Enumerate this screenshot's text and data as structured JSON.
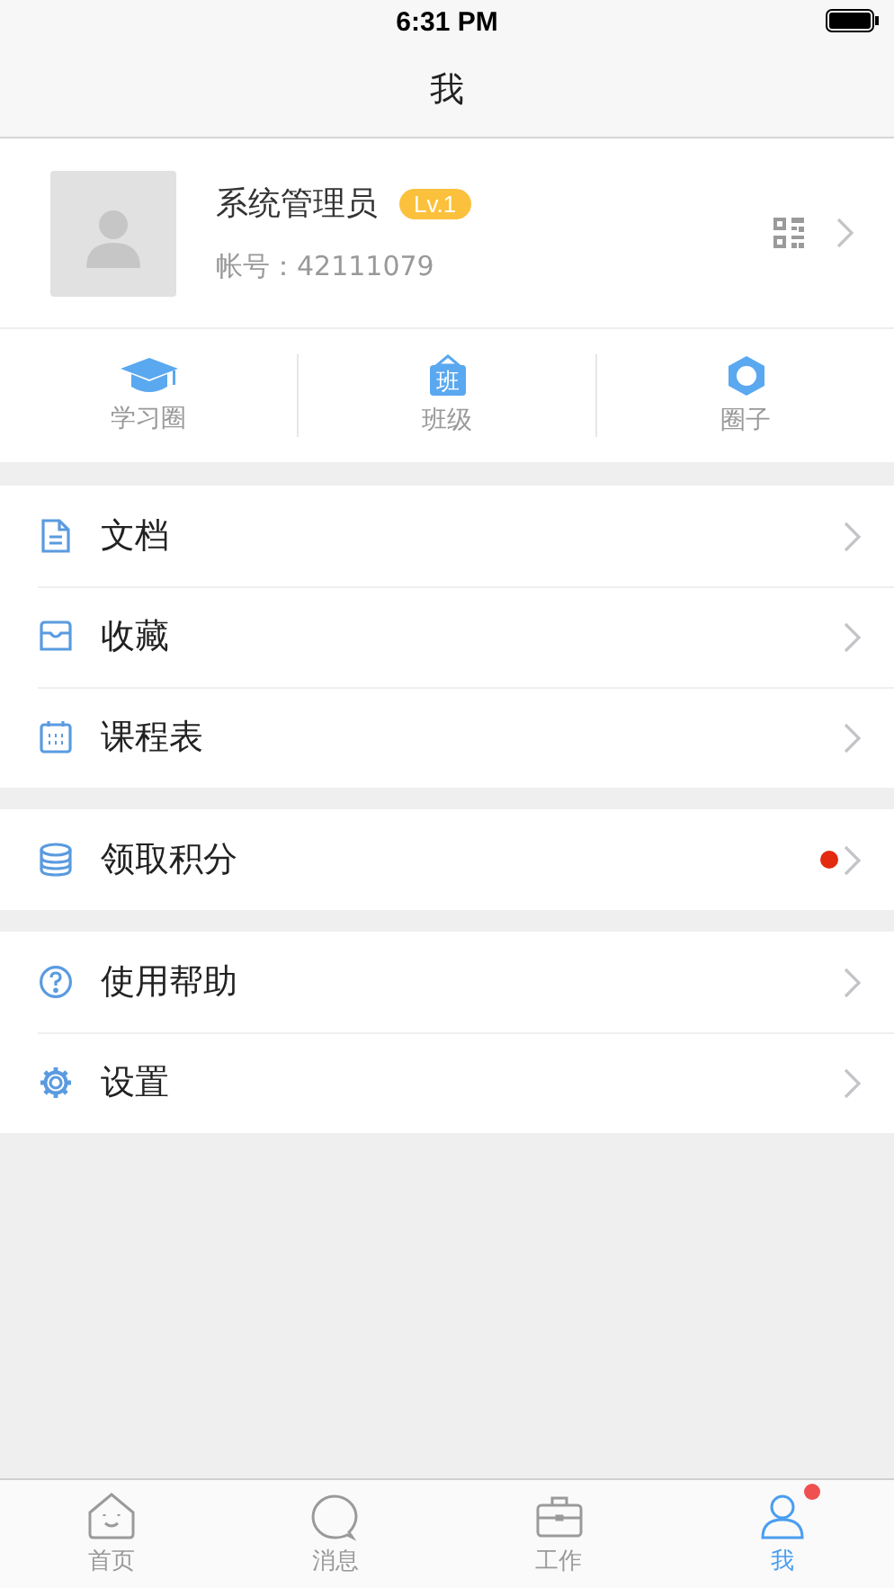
{
  "status_bar": {
    "time": "6:31 PM"
  },
  "nav": {
    "title": "我"
  },
  "profile": {
    "name": "系统管理员",
    "level_badge": "Lv.1",
    "account_label": "帐号：",
    "account": "42111079"
  },
  "shortcuts": [
    {
      "kind": "cap",
      "label": "学习圈"
    },
    {
      "kind": "class",
      "label": "班级",
      "icon_text": "班"
    },
    {
      "kind": "hex",
      "label": "圈子"
    }
  ],
  "menu_groups": [
    [
      {
        "kind": "doc",
        "label": "文档",
        "dot": false
      },
      {
        "kind": "inbox",
        "label": "收藏",
        "dot": false
      },
      {
        "kind": "calendar",
        "label": "课程表",
        "dot": false
      }
    ],
    [
      {
        "kind": "coins",
        "label": "领取积分",
        "dot": true
      }
    ],
    [
      {
        "kind": "help",
        "label": "使用帮助",
        "dot": false
      },
      {
        "kind": "gear",
        "label": "设置",
        "dot": false
      }
    ]
  ],
  "tab_bar": [
    {
      "kind": "home",
      "label": "首页",
      "selected": false,
      "dot": false
    },
    {
      "kind": "chat",
      "label": "消息",
      "selected": false,
      "dot": false
    },
    {
      "kind": "work",
      "label": "工作",
      "selected": false,
      "dot": false
    },
    {
      "kind": "me",
      "label": "我",
      "selected": true,
      "dot": true
    }
  ]
}
